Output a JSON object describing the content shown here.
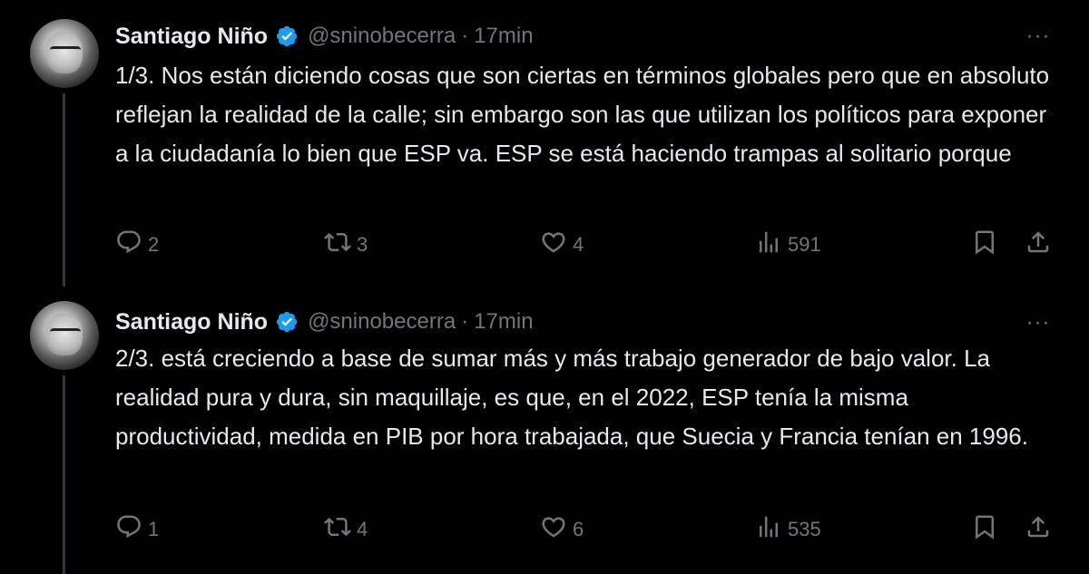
{
  "tweets": [
    {
      "author": {
        "name": "Santiago Niño",
        "handle": "@sninobecerra",
        "separator": "·",
        "time": "17min"
      },
      "more_label": "···",
      "text": "1/3. Nos están diciendo cosas que son ciertas en términos globales pero que en absoluto reflejan la realidad de la calle; sin embargo son las que utilizan los políticos para exponer a la ciudadanía lo bien que ESP va. ESP se está haciendo trampas al solitario porque",
      "stats": {
        "replies": "2",
        "retweets": "3",
        "likes": "4",
        "views": "591"
      }
    },
    {
      "author": {
        "name": "Santiago Niño",
        "handle": "@sninobecerra",
        "separator": "·",
        "time": "17min"
      },
      "more_label": "···",
      "text": "2/3. está creciendo a base de sumar más y más trabajo generador de bajo valor. La realidad pura y dura, sin maquillaje, es que, en el 2022, ESP tenía la misma productividad, medida en PIB por hora trabajada, que Suecia y Francia tenían en 1996.",
      "stats": {
        "replies": "1",
        "retweets": "4",
        "likes": "6",
        "views": "535"
      }
    }
  ],
  "icons": {
    "verified": "verified-badge-icon",
    "reply": "reply-icon",
    "retweet": "retweet-icon",
    "like": "heart-icon",
    "views": "views-chart-icon",
    "bookmark": "bookmark-icon",
    "share": "share-icon"
  },
  "colors": {
    "background": "#000000",
    "text": "#e7e9ea",
    "muted": "#71767b",
    "verified": "#1d9bf0",
    "thread_line": "#333639"
  }
}
